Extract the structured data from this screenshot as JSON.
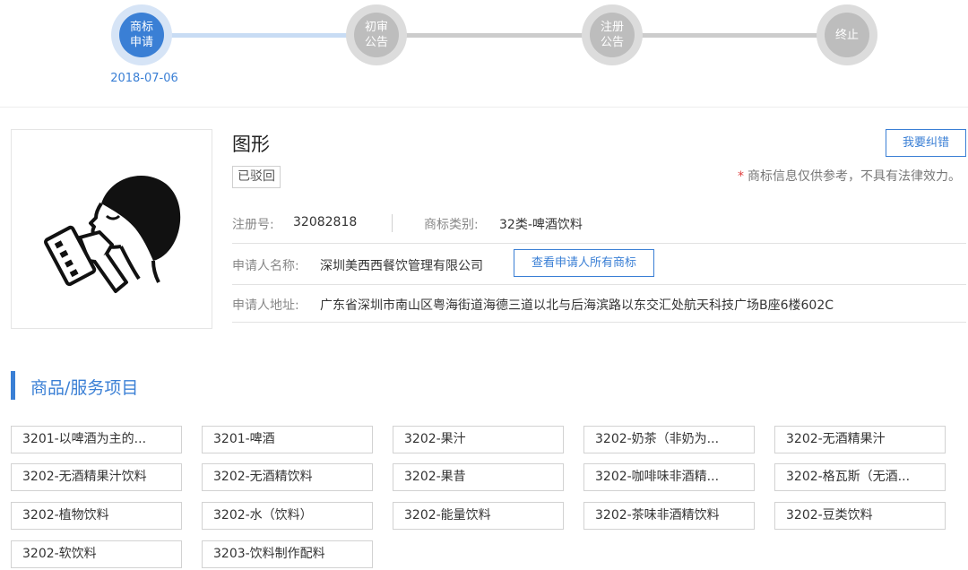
{
  "progress": {
    "steps": [
      {
        "label": "商标申请",
        "state": "active"
      },
      {
        "label": "初审公告",
        "state": "inactive"
      },
      {
        "label": "注册公告",
        "state": "inactive"
      },
      {
        "label": "终止",
        "state": "inactive"
      }
    ],
    "date": "2018-07-06"
  },
  "trademark": {
    "name": "图形",
    "status": "已驳回",
    "correction_button": "我要纠错",
    "disclaimer_star": "*",
    "disclaimer": "商标信息仅供参考，不具有法律效力。",
    "reg_no_label": "注册号:",
    "reg_no": "32082818",
    "category_label": "商标类别:",
    "category": "32类-啤酒饮料",
    "applicant_label": "申请人名称:",
    "applicant": "深圳美西西餐饮管理有限公司",
    "view_all_button": "查看申请人所有商标",
    "address_label": "申请人地址:",
    "address": "广东省深圳市南山区粤海街道海德三道以北与后海滨路以东交汇处航天科技广场B座6楼602C",
    "image_icon": "person-drinking-icon"
  },
  "goods_section": {
    "title": "商品/服务项目",
    "items": [
      "3201-以啤酒为主的...",
      "3201-啤酒",
      "3202-果汁",
      "3202-奶茶（非奶为...",
      "3202-无酒精果汁",
      "3202-无酒精果汁饮料",
      "3202-无酒精饮料",
      "3202-果昔",
      "3202-咖啡味非酒精...",
      "3202-格瓦斯（无酒...",
      "3202-植物饮料",
      "3202-水（饮料）",
      "3202-能量饮料",
      "3202-茶味非酒精饮料",
      "3202-豆类饮料",
      "3202-软饮料",
      "3203-饮料制作配料"
    ]
  },
  "colors": {
    "accent": "#3a7fd5",
    "inactive_step": "#bdbdbd",
    "warning_star": "#e04040"
  }
}
